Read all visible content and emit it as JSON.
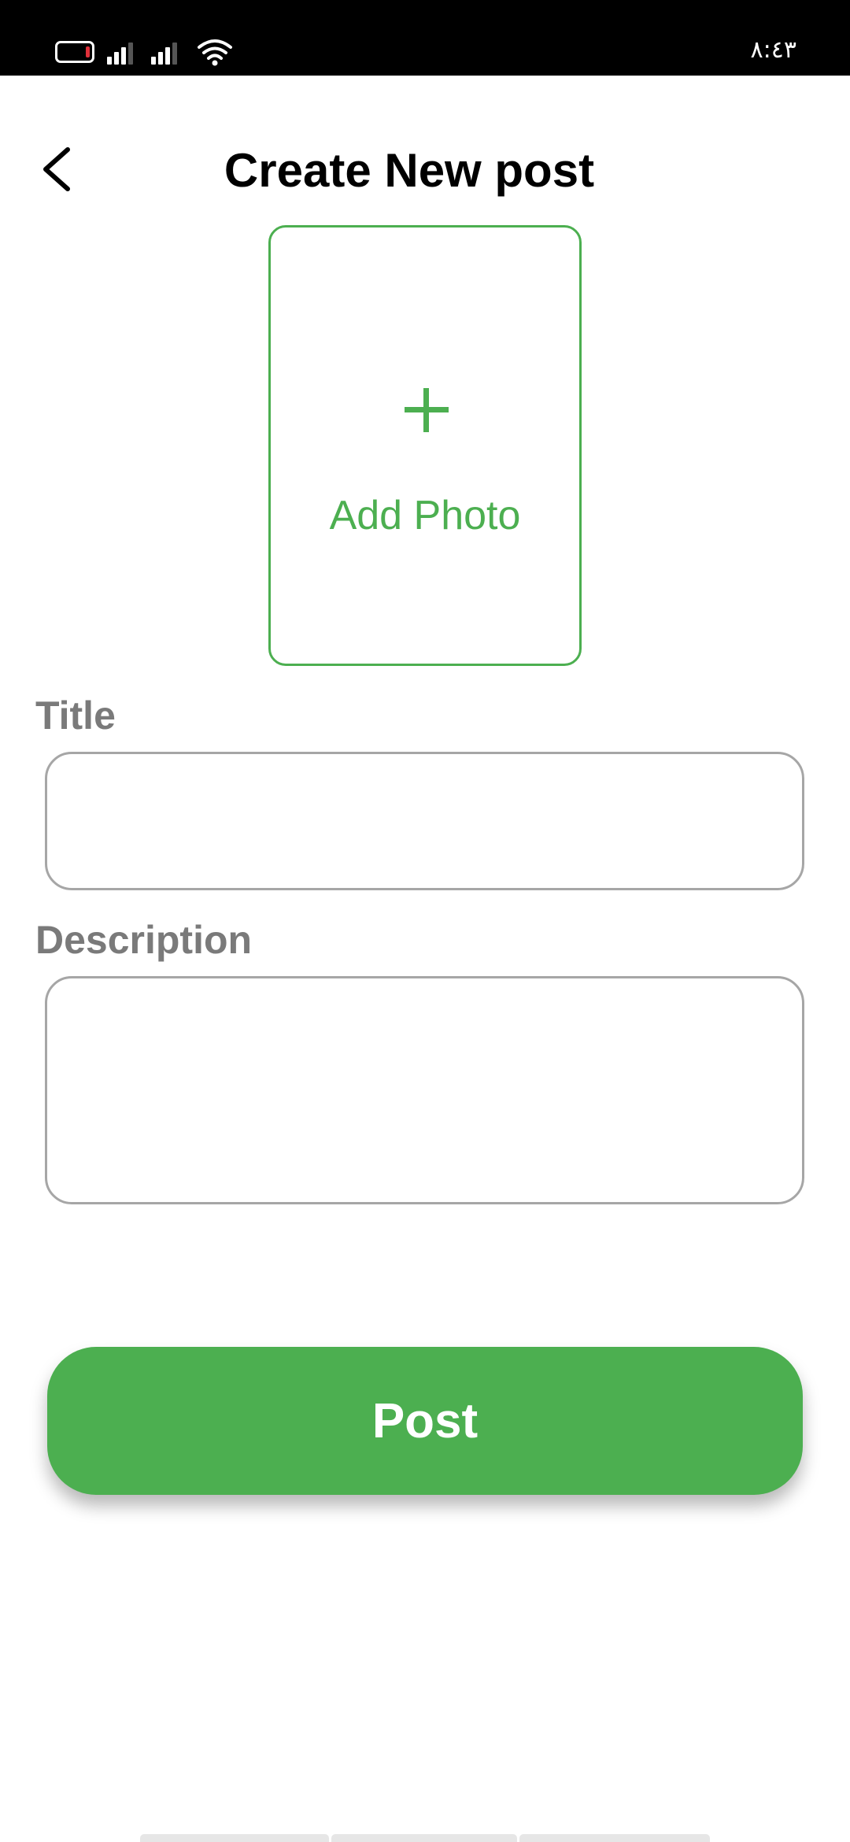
{
  "status_bar": {
    "time": "٨:٤٣",
    "icons": [
      "battery-icon",
      "signal-icon",
      "signal-icon",
      "wifi-icon"
    ]
  },
  "header": {
    "title": "Create New post",
    "back_icon": "chevron-left-icon"
  },
  "photo_picker": {
    "icon": "plus-icon",
    "label": "Add Photo"
  },
  "form": {
    "title_label": "Title",
    "title_value": "",
    "title_placeholder": "",
    "description_label": "Description",
    "description_value": "",
    "description_placeholder": ""
  },
  "actions": {
    "post_label": "Post"
  },
  "colors": {
    "accent": "#4caf50",
    "label_gray": "#7a7a7a",
    "border_gray": "#a6a6a6",
    "status_bar": "#000000",
    "battery_low": "#e0303a"
  }
}
